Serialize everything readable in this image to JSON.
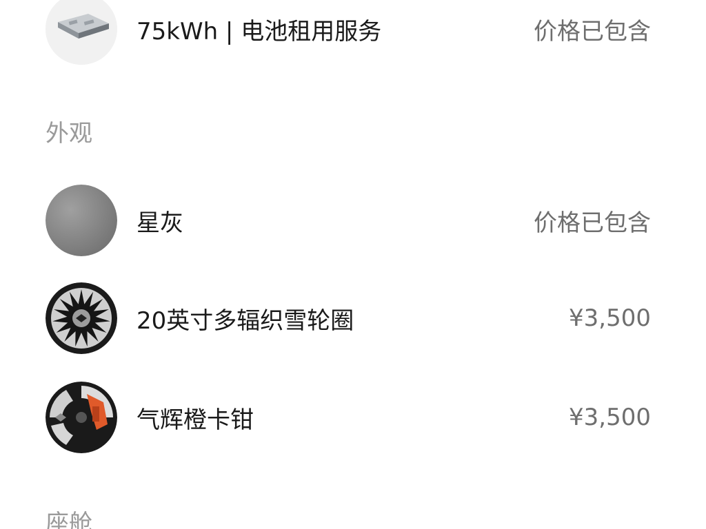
{
  "battery": {
    "icon": "battery-pack-icon",
    "name": "75kWh | 电池租用服务",
    "price": "价格已包含"
  },
  "sections": {
    "exterior": "外观",
    "cabin": "座舱"
  },
  "options": [
    {
      "icon": "star-grey-swatch-icon",
      "name": "星灰",
      "price": "价格已包含"
    },
    {
      "icon": "multi-spoke-wheel-icon",
      "name": "20英寸多辐织雪轮圈",
      "price": "¥3,500"
    },
    {
      "icon": "orange-caliper-icon",
      "name": "气辉橙卡钳",
      "price": "¥3,500"
    }
  ],
  "colors": {
    "paint_grey": "#8a8a8a",
    "caliper_orange": "#e05a2a"
  }
}
